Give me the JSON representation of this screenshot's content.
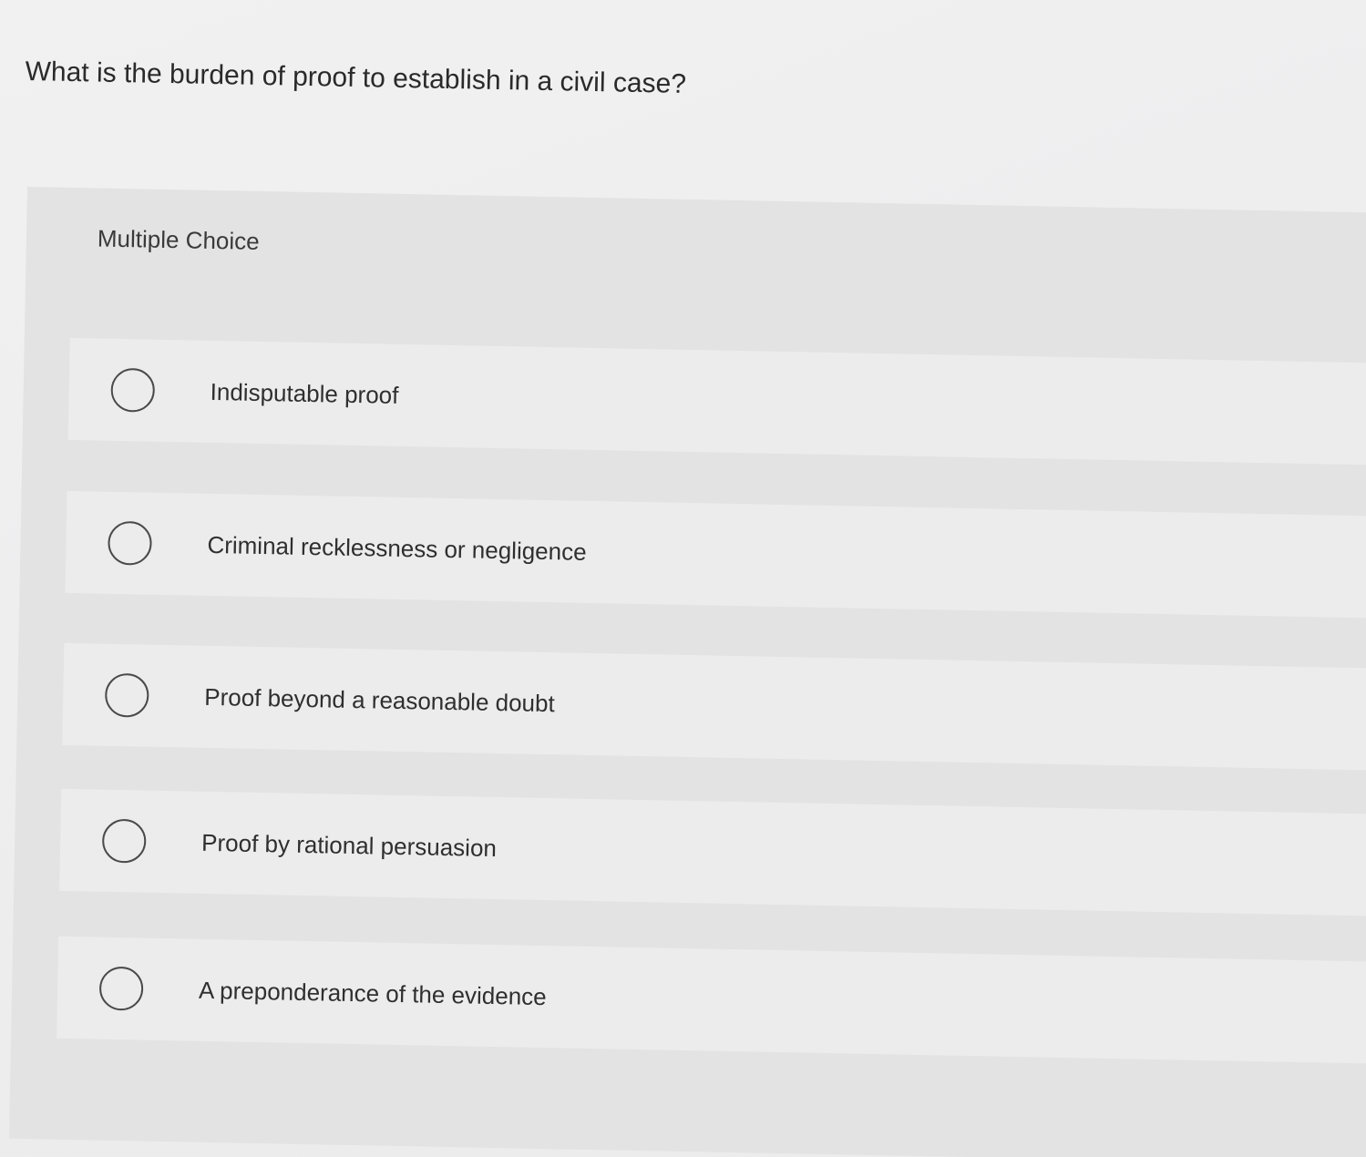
{
  "question": {
    "text": "What is the burden of proof to establish in a civil case?"
  },
  "question_type": "Multiple Choice",
  "options": [
    {
      "label": "Indisputable proof",
      "selected": false
    },
    {
      "label": "Criminal recklessness or negligence",
      "selected": false
    },
    {
      "label": "Proof beyond a reasonable doubt",
      "selected": false
    },
    {
      "label": "Proof by rational persuasion",
      "selected": false
    },
    {
      "label": "A preponderance of the evidence",
      "selected": false
    }
  ],
  "colors": {
    "page_background": "#eeeeee",
    "panel_background": "#e3e3e4",
    "option_background": "#ececec",
    "radio_border": "#4a4a4a",
    "text": "#2b2b2b"
  }
}
